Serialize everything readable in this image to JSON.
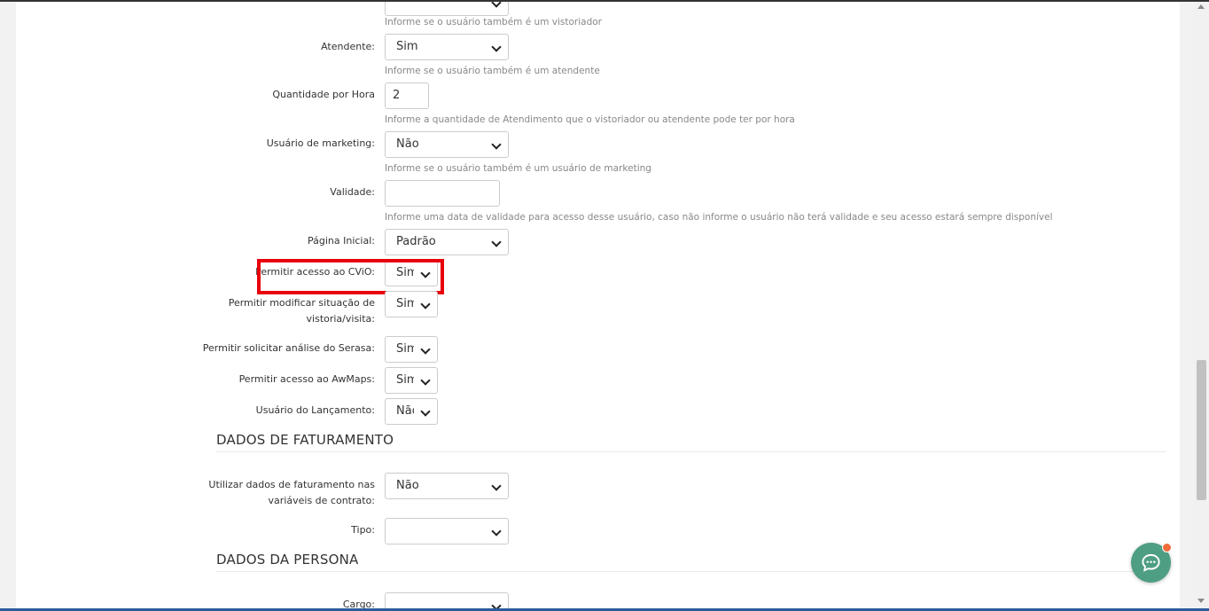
{
  "form": {
    "vistoriador_help": "Informe se o usuário também é um vistoriador",
    "atendente": {
      "label": "Atendente:",
      "value": "Sim",
      "help": "Informe se o usuário também é um atendente"
    },
    "quantidade_por_hora": {
      "label": "Quantidade por Hora",
      "value": "2",
      "help": "Informe a quantidade de Atendimento que o vistoriador ou atendente pode ter por hora"
    },
    "usuario_marketing": {
      "label": "Usuário de marketing:",
      "value": "Não",
      "help": "Informe se o usuário também é um usuário de marketing"
    },
    "validade": {
      "label": "Validade:",
      "value": "",
      "help": "Informe uma data de validade para acesso desse usuário, caso não informe o usuário não terá validade e seu acesso estará sempre disponível"
    },
    "pagina_inicial": {
      "label": "Página Inicial:",
      "value": "Padrão"
    },
    "permitir_cvio": {
      "label": "Permitir acesso ao CViO:",
      "value": "Sim"
    },
    "permitir_modificar": {
      "label_line1": "Permitir modificar situação de",
      "label_line2": "vistoria/visita:",
      "value": "Sim"
    },
    "permitir_serasa": {
      "label": "Permitir solicitar análise do Serasa:",
      "value": "Sim"
    },
    "permitir_awmaps": {
      "label": "Permitir acesso ao AwMaps:",
      "value": "Sim"
    },
    "usuario_lancamento": {
      "label": "Usuário do Lançamento:",
      "value": "Não"
    }
  },
  "faturamento": {
    "title": "DADOS DE FATURAMENTO",
    "utilizar": {
      "label_line1": "Utilizar dados de faturamento nas",
      "label_line2": "variáveis de contrato:",
      "value": "Não"
    },
    "tipo": {
      "label": "Tipo:",
      "value": ""
    }
  },
  "persona": {
    "title": "DADOS DA PERSONA",
    "cargo": {
      "label": "Cargo:",
      "value": ""
    }
  },
  "colors": {
    "highlight": "#e8000b",
    "chat": "#4e9e83",
    "notification": "#f26b3a"
  },
  "icons": {
    "chat": "chat-bubble-icon",
    "dropdown": "chevron-down-icon"
  }
}
